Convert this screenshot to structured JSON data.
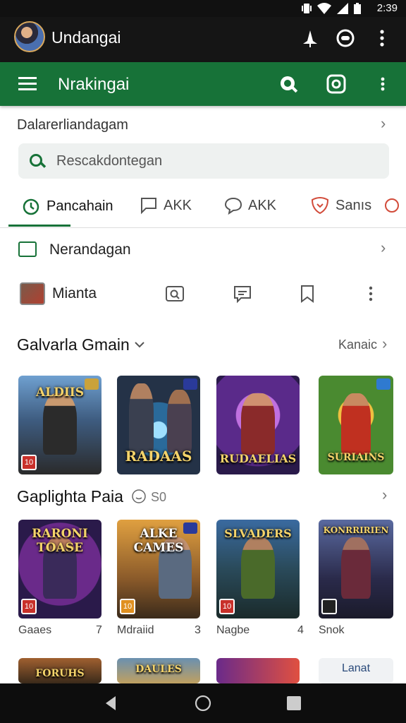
{
  "status_bar": {
    "time": "2:39"
  },
  "app_bar": {
    "title": "Undangai"
  },
  "green_bar": {
    "title": "Nrakingai"
  },
  "subheader": {
    "text": "Dalarerliandagam"
  },
  "search": {
    "placeholder": "Rescakdontegan"
  },
  "tabs": [
    {
      "label": "Pancahain"
    },
    {
      "label": "AKK"
    },
    {
      "label": "AKK"
    },
    {
      "label": "Sanıs"
    }
  ],
  "list": {
    "row1_label": "Nerandagan",
    "row2_label": "Mianta"
  },
  "section1": {
    "title": "Galvarla Gmain",
    "link": "Kanaic"
  },
  "section2": {
    "title": "Gaplighta Paia",
    "meta": "S0"
  },
  "cards_row1": [
    {
      "title": "ALDIIS",
      "badge": "10"
    },
    {
      "title": "RADAAS",
      "badge": ""
    },
    {
      "title": "RUDAELIAS",
      "badge": ""
    },
    {
      "title": "SURIAINS",
      "badge": ""
    }
  ],
  "cards_row2": [
    {
      "title": "RARONI TOASE",
      "badge": "10",
      "caption": "Gaaes",
      "count": "7"
    },
    {
      "title": "ALKE CAMES",
      "badge": "10",
      "caption": "Mdraiid",
      "count": "3"
    },
    {
      "title": "SLVADERS",
      "badge": "10",
      "caption": "Nagbe",
      "count": "4"
    },
    {
      "title": "KONRRIRIEN",
      "badge": "",
      "caption": "Snok",
      "count": ""
    }
  ],
  "cards_row3": [
    {
      "title": "FORUHS"
    },
    {
      "title": "DAULES"
    },
    {
      "title": ""
    },
    {
      "title": "Lanat"
    }
  ],
  "colors": {
    "primary_green": "#177238",
    "app_bar": "#151515",
    "status_bar": "#111111"
  }
}
